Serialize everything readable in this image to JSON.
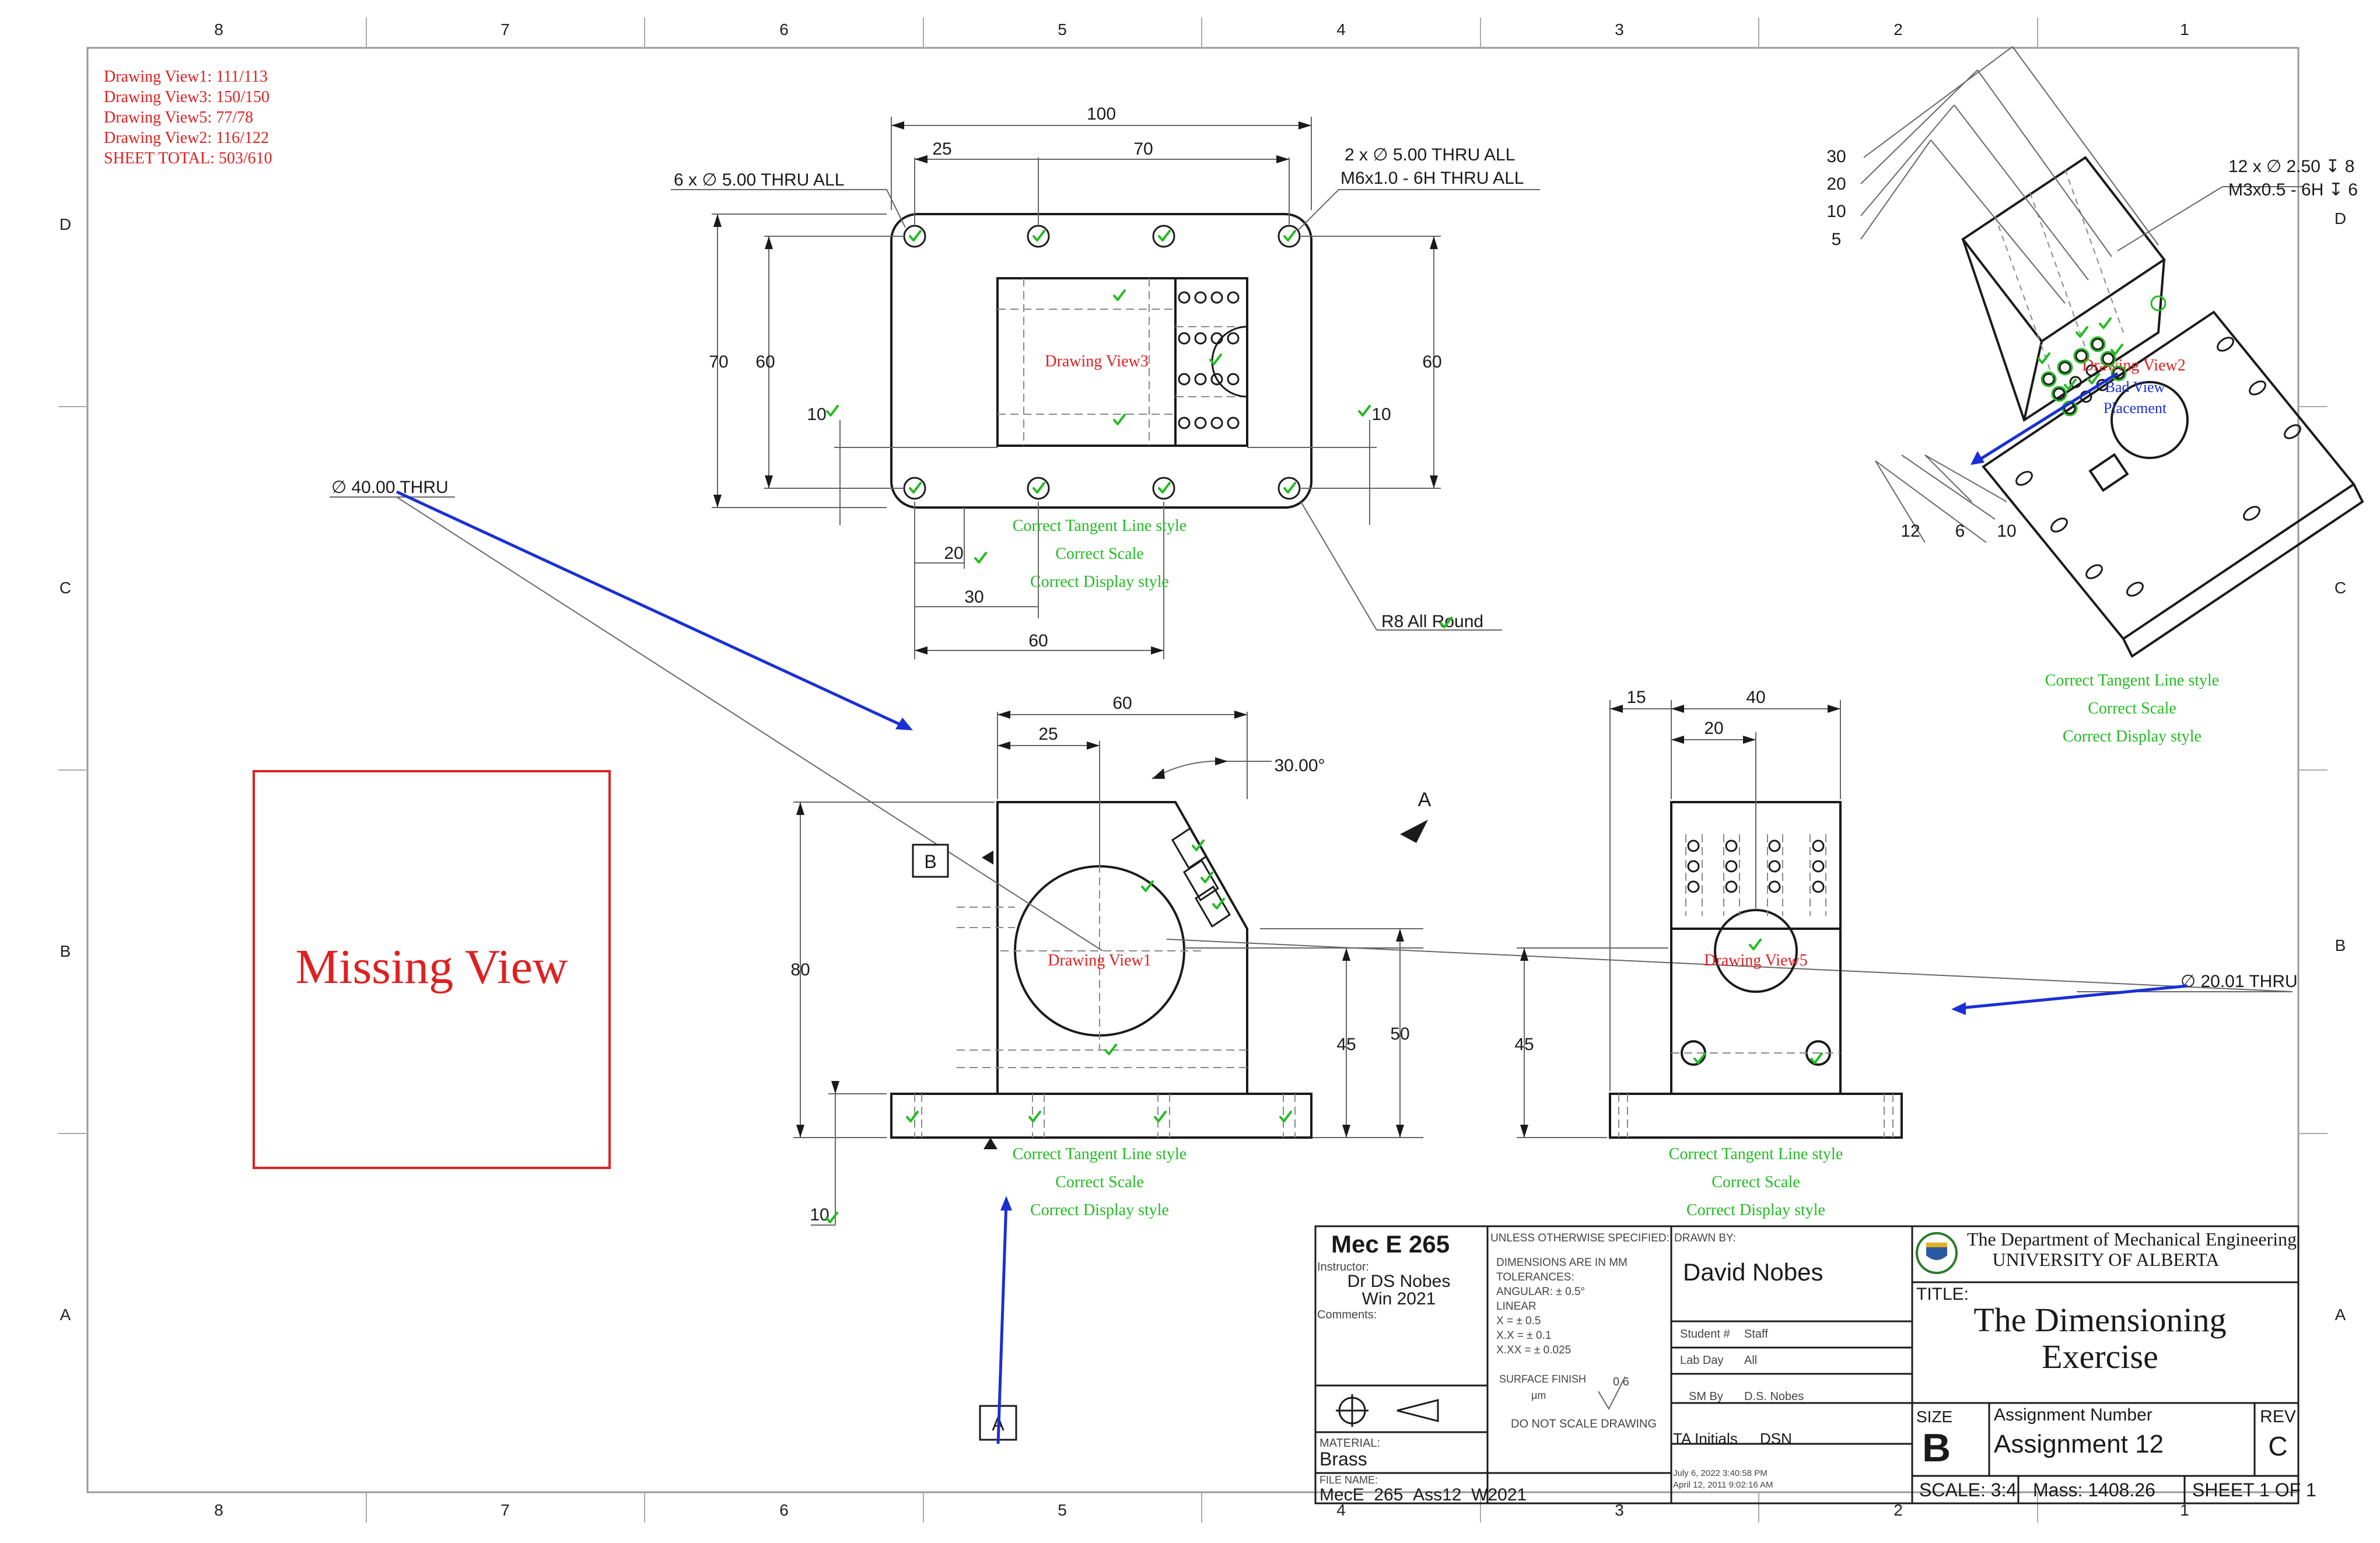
{
  "zones": {
    "columns": [
      "8",
      "7",
      "6",
      "5",
      "4",
      "3",
      "2",
      "1"
    ],
    "rows": [
      "D",
      "C",
      "B",
      "A"
    ]
  },
  "grading_summary": [
    "Drawing View1: 111/113",
    "Drawing View3: 150/150",
    "Drawing View5: 77/78",
    "Drawing View2: 116/122",
    "SHEET TOTAL: 503/610"
  ],
  "missing_view_label": "Missing View",
  "view_labels": {
    "view1": "Drawing View1",
    "view3": "Drawing View3",
    "view5": "Drawing View5",
    "view2": "Drawing View2",
    "bad_view_1": "Bad View",
    "bad_view_2": "Placement"
  },
  "feedback_lines": [
    "Correct Tangent Line style",
    "Correct Scale",
    "Correct Display style"
  ],
  "top_view_dims": {
    "overall": "100",
    "d25": "25",
    "d70": "70",
    "v70": "70",
    "v60": "60",
    "v60r": "60",
    "v10l": "10",
    "v10r": "10",
    "h20": "20",
    "h30": "30",
    "h60": "60",
    "hole_note": "6 x ∅ 5.00 THRU ALL",
    "tap_note_1": "2 x ∅ 5.00 THRU ALL",
    "tap_note_2": "M6x1.0 - 6H THRU ALL",
    "fillet_note": "R8 All Round"
  },
  "front_view_dims": {
    "d60": "60",
    "d25": "25",
    "angle": "30.00°",
    "v80": "80",
    "v45": "45",
    "v50": "50",
    "v10": "10",
    "bore_note": "∅ 40.00 THRU",
    "datum_b": "B",
    "datum_a": "A",
    "section_a": "A"
  },
  "side_view_dims": {
    "d15": "15",
    "d40": "40",
    "d20": "20",
    "v45": "45",
    "bore_note": "∅ 20.01 THRU"
  },
  "iso_view_dims": {
    "d30": "30",
    "d20": "20",
    "d10": "10",
    "d5": "5",
    "d12": "12",
    "d6": "6",
    "d10b": "10",
    "hole_note_1": "12 x ∅ 2.50 ↧ 8",
    "hole_note_2": "M3x0.5 - 6H ↧ 6"
  },
  "title_block": {
    "course": "Mec E 265",
    "instructor_label": "Instructor:",
    "instructor": "Dr DS Nobes",
    "term": "Win 2021",
    "comments_label": "Comments:",
    "unless_label": "UNLESS OTHERWISE SPECIFIED:",
    "tol_lines": [
      "DIMENSIONS ARE IN MM",
      "TOLERANCES:",
      "ANGULAR: ± 0.5°",
      "LINEAR",
      "X      = ± 0.5",
      "X.X    = ± 0.1",
      "X.XX  = ± 0.025"
    ],
    "surface_finish_label": "SURFACE FINISH",
    "surface_finish_unit": "μm",
    "surface_finish_value": "0.6",
    "do_not_scale": "DO NOT SCALE DRAWING",
    "material_label": "MATERIAL:",
    "material": "Brass",
    "file_label": "FILE NAME:",
    "file_name": "MecE_265_Ass12_W2021",
    "drawn_by_label": "DRAWN BY:",
    "drawn_by": "David Nobes",
    "student_label": "Student #",
    "student": "Staff",
    "lab_day_label": "Lab Day",
    "lab_day": "All",
    "sm_by_label": "SM By",
    "sm_by": "D.S. Nobes",
    "ta_label": "TA Initials",
    "ta": "DSN",
    "date1": "July 6, 2022 3:40:58 PM",
    "date2": "April 12, 2011 9:02:16 AM",
    "dept_1": "The Department of Mechanical Engineering",
    "dept_2": "UNIVERSITY OF ALBERTA",
    "title_label": "TITLE:",
    "title_1": "The Dimensioning",
    "title_2": "Exercise",
    "size_label": "SIZE",
    "size": "B",
    "assign_label": "Assignment  Number",
    "assignment": "Assignment 12",
    "rev_label": "REV",
    "rev": "C",
    "scale": "SCALE: 3:4",
    "mass": "Mass: 1408.26",
    "sheet": "SHEET 1 OF 1"
  },
  "colors": {
    "line": "#1a1a1a",
    "red": "#e02020",
    "green": "#22bb22",
    "blue": "#1a2fd6",
    "thin": "#555555"
  }
}
